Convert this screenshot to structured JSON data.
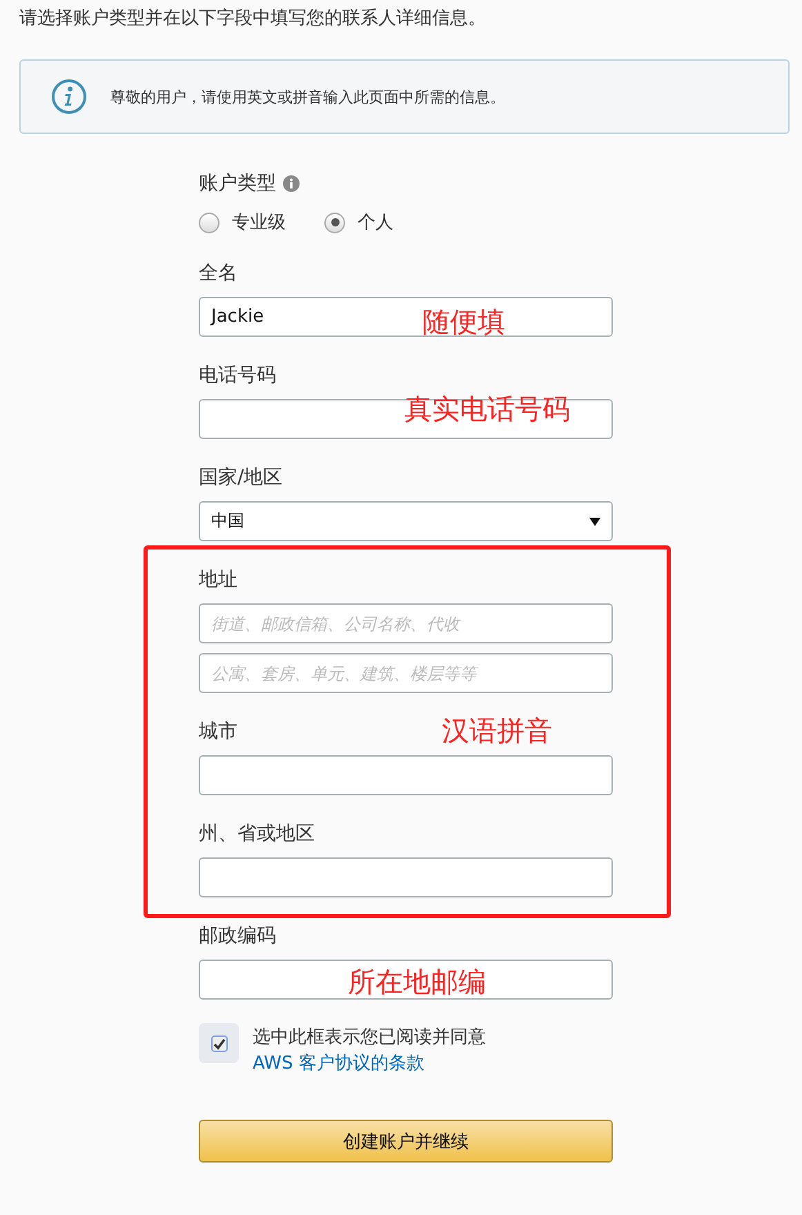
{
  "intro": "请选择账户类型并在以下字段中填写您的联系人详细信息。",
  "notice": "尊敬的用户，请使用英文或拼音输入此页面中所需的信息。",
  "account_type": {
    "label": "账户类型",
    "options": [
      {
        "label": "专业级",
        "selected": false
      },
      {
        "label": "个人",
        "selected": true
      }
    ]
  },
  "fields": [
    {
      "kind": "text",
      "label": "全名",
      "value": "Jackie"
    },
    {
      "kind": "text",
      "label": "电话号码"
    },
    {
      "kind": "select",
      "label": "国家/地区",
      "value": "中国"
    },
    {
      "kind": "address",
      "label": "地址",
      "placeholders": [
        "街道、邮政信箱、公司名称、代收",
        "公寓、套房、单元、建筑、楼层等等"
      ]
    },
    {
      "kind": "text",
      "label": "城市"
    },
    {
      "kind": "text",
      "label": "州、省或地区"
    },
    {
      "kind": "text",
      "label": "邮政编码"
    }
  ],
  "agreement": {
    "checked": true,
    "text": "选中此框表示您已阅读并同意 ",
    "link": "AWS 客户协议的条款"
  },
  "button": "创建账户并继续",
  "annotations": [
    {
      "text": "随便填"
    },
    {
      "text": "真实电话号码"
    },
    {
      "text": "汉语拼音"
    },
    {
      "text": "所在地邮编"
    }
  ]
}
